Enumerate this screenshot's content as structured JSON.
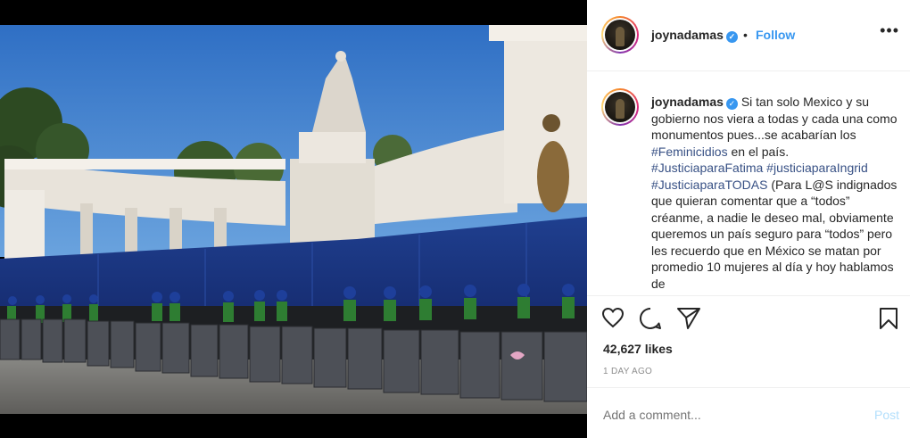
{
  "post": {
    "username": "joynadamas",
    "dot": "•",
    "follow_label": "Follow",
    "more_label": "•••",
    "caption": {
      "part1": " Si tan solo Mexico y su gobierno nos viera a todas y cada una como monumentos pues...se acabarían los ",
      "tag1": "#Feminicidios",
      "part2": " en el país. ",
      "tag2": "#JusticiaparaFatima",
      "tag3": "#justiciaparaIngrid",
      "tag4": "#JusticiaparaTODAS",
      "part3": " (Para L@S indignados que quieran comentar que a “todos” créanme, a nadie le deseo mal, obviamente queremos un país seguro para “todos” pero les recuerdo que en México se matan por promedio 10 mujeres al día y hoy hablamos de"
    },
    "likes": "42,627 likes",
    "date": "1 DAY AGO",
    "comment_placeholder": "Add a comment...",
    "post_label": "Post",
    "verified_mark": "✓"
  },
  "colors": {
    "accent": "#3897f0",
    "hashtag": "#385185",
    "post_disabled": "#b2dffc"
  },
  "icons": [
    "heart-icon",
    "comment-icon",
    "share-icon",
    "bookmark-icon",
    "verified-icon",
    "more-icon"
  ]
}
